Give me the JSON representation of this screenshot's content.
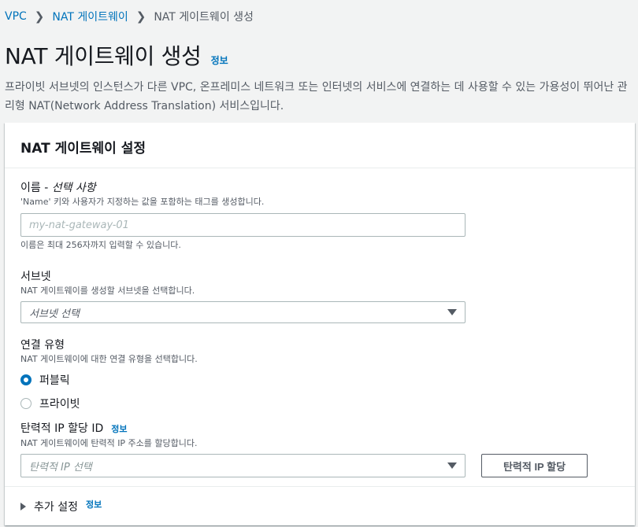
{
  "breadcrumb": {
    "items": [
      "VPC",
      "NAT 게이트웨이"
    ],
    "current": "NAT 게이트웨이 생성"
  },
  "page": {
    "title": "NAT 게이트웨이 생성",
    "info_label": "정보",
    "description": "프라이빗 서브넷의 인스턴스가 다른 VPC, 온프레미스 네트워크 또는 인터넷의 서비스에 연결하는 데 사용할 수 있는 가용성이 뛰어난 관리형 NAT(Network Address Translation) 서비스입니다."
  },
  "panel": {
    "title": "NAT 게이트웨이 설정",
    "name_field": {
      "label": "이름 - ",
      "optional": "선택 사항",
      "description": "'Name' 키와 사용자가 지정하는 값을 포함하는 태그를 생성합니다.",
      "value": "",
      "placeholder": "my-nat-gateway-01",
      "constraint": "이름은 최대 256자까지 입력할 수 있습니다."
    },
    "subnet_field": {
      "label": "서브넷",
      "description": "NAT 게이트웨이를 생성할 서브넷을 선택합니다.",
      "selected": "서브넷 선택"
    },
    "connectivity_field": {
      "label": "연결 유형",
      "description": "NAT 게이트웨이에 대한 연결 유형을 선택합니다.",
      "options": [
        {
          "label": "퍼블릭",
          "checked": true
        },
        {
          "label": "프라이빗",
          "checked": false
        }
      ]
    },
    "eip_field": {
      "label": "탄력적 IP 할당 ID",
      "info_label": "정보",
      "description": "NAT 게이트웨이에 탄력적 IP 주소를 할당합니다.",
      "selected": "탄력적 IP 선택",
      "button": "탄력적 IP 할당"
    },
    "additional_settings": {
      "label": "추가 설정",
      "info_label": "정보"
    }
  },
  "colors": {
    "accent": "#0073bb",
    "background": "#f2f3f3"
  }
}
